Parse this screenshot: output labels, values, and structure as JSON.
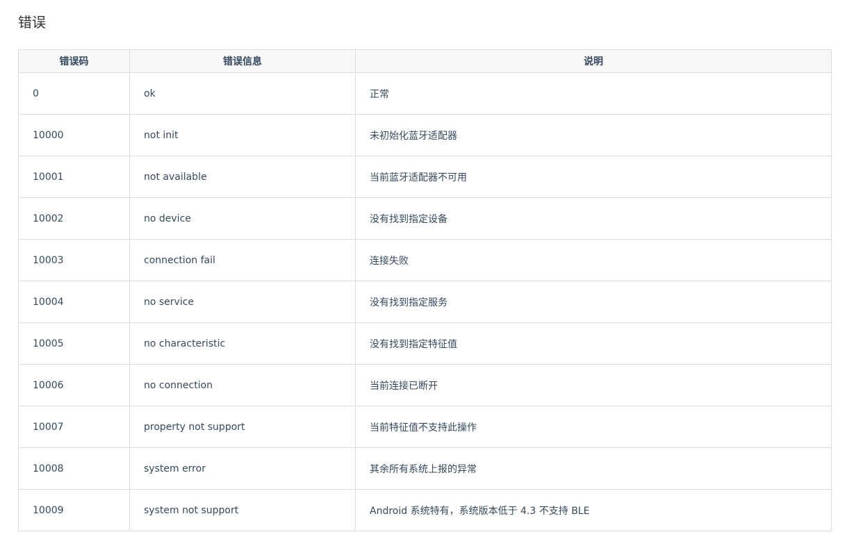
{
  "section": {
    "title": "错误"
  },
  "table": {
    "headers": [
      "错误码",
      "错误信息",
      "说明"
    ],
    "rows": [
      {
        "code": "0",
        "message": "ok",
        "description": "正常"
      },
      {
        "code": "10000",
        "message": "not init",
        "description": "未初始化蓝牙适配器"
      },
      {
        "code": "10001",
        "message": "not available",
        "description": "当前蓝牙适配器不可用"
      },
      {
        "code": "10002",
        "message": "no device",
        "description": "没有找到指定设备"
      },
      {
        "code": "10003",
        "message": "connection fail",
        "description": "连接失败"
      },
      {
        "code": "10004",
        "message": "no service",
        "description": "没有找到指定服务"
      },
      {
        "code": "10005",
        "message": "no characteristic",
        "description": "没有找到指定特征值"
      },
      {
        "code": "10006",
        "message": "no connection",
        "description": "当前连接已断开"
      },
      {
        "code": "10007",
        "message": "property not support",
        "description": "当前特征值不支持此操作"
      },
      {
        "code": "10008",
        "message": "system error",
        "description": "其余所有系统上报的异常"
      },
      {
        "code": "10009",
        "message": "system not support",
        "description": "Android 系统特有，系统版本低于 4.3 不支持 BLE"
      }
    ]
  }
}
